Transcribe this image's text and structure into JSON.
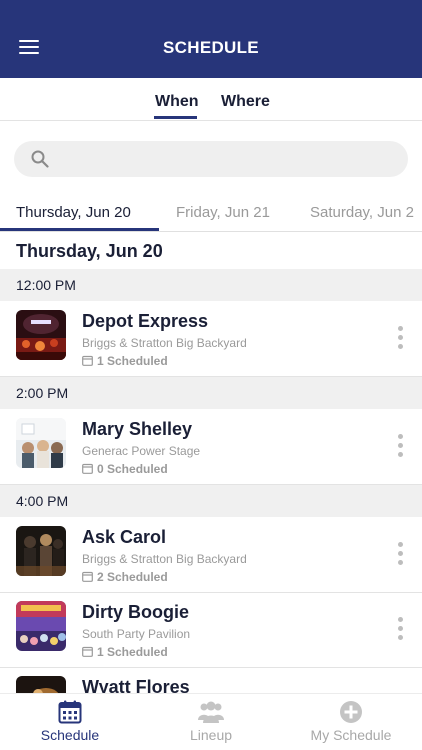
{
  "header": {
    "title": "SCHEDULE"
  },
  "segment_tabs": {
    "when": "When",
    "where": "Where",
    "active": "when"
  },
  "search": {
    "placeholder": ""
  },
  "date_tabs": [
    {
      "label": "Thursday, Jun 20",
      "active": true
    },
    {
      "label": "Friday, Jun 21",
      "active": false
    },
    {
      "label": "Saturday, Jun 2",
      "active": false
    }
  ],
  "day_heading": "Thursday, Jun 20",
  "time_slots": [
    {
      "time": "12:00 PM"
    },
    {
      "time": "2:00 PM"
    },
    {
      "time": "4:00 PM"
    }
  ],
  "events": [
    {
      "name": "Depot Express",
      "venue": "Briggs & Stratton Big Backyard",
      "scheduled": "1 Scheduled"
    },
    {
      "name": "Mary Shelley",
      "venue": "Generac Power Stage",
      "scheduled": "0 Scheduled"
    },
    {
      "name": "Ask Carol",
      "venue": "Briggs & Stratton Big Backyard",
      "scheduled": "2 Scheduled"
    },
    {
      "name": "Dirty Boogie",
      "venue": "South Party Pavilion",
      "scheduled": "1 Scheduled"
    },
    {
      "name": "Wyatt Flores",
      "venue": "",
      "scheduled": ""
    }
  ],
  "bottom_nav": [
    {
      "label": "Schedule",
      "icon": "calendar-icon",
      "active": true
    },
    {
      "label": "Lineup",
      "icon": "people-icon",
      "active": false
    },
    {
      "label": "My Schedule",
      "icon": "plus-circle-icon",
      "active": false
    }
  ],
  "colors": {
    "brand": "#27357a",
    "muted": "#9a9a9a",
    "section_bg": "#f0f0f0"
  }
}
